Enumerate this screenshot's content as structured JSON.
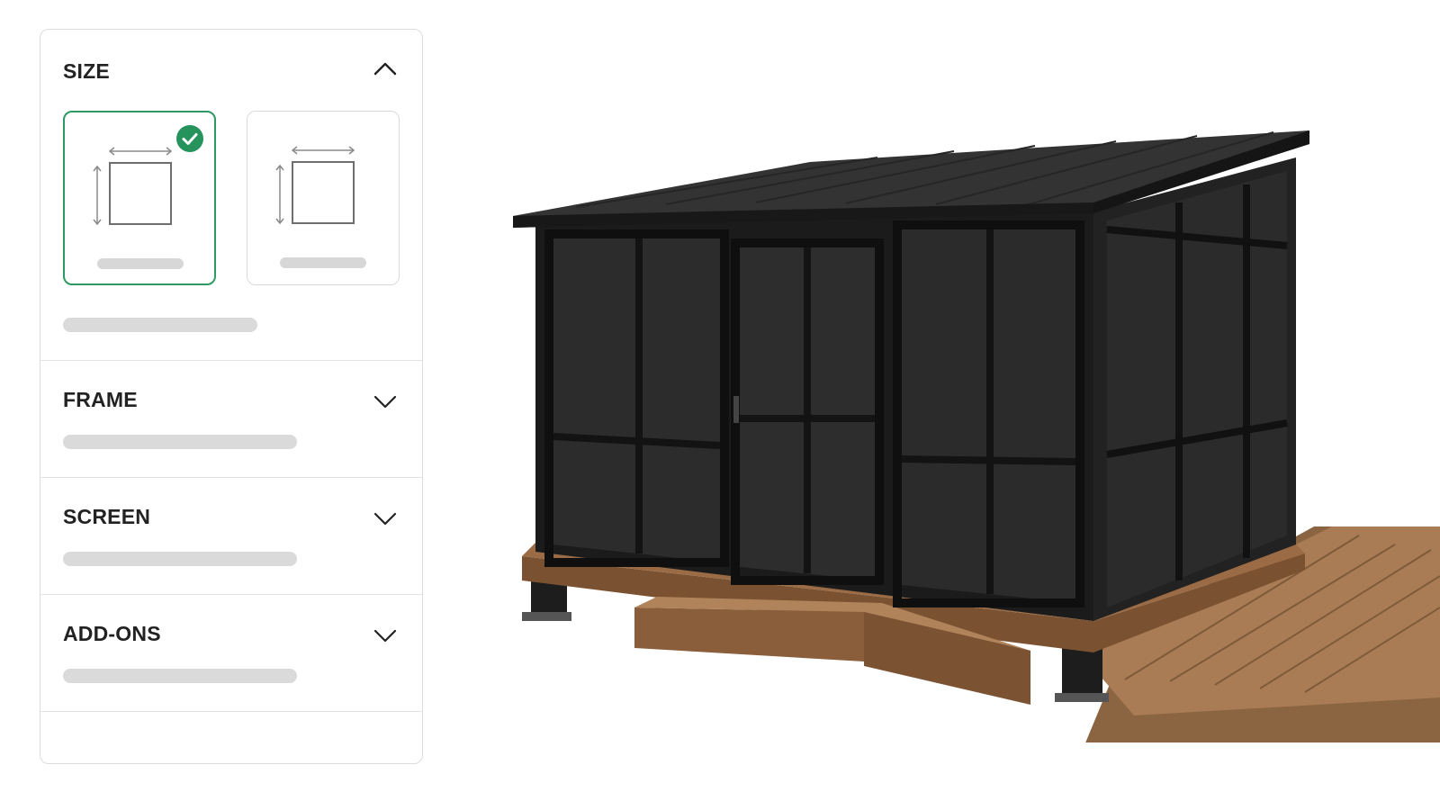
{
  "sections": {
    "size": {
      "title": "SIZE",
      "expanded": true,
      "selected_option": 1
    },
    "frame": {
      "title": "FRAME",
      "expanded": false
    },
    "screen": {
      "title": "SCREEN",
      "expanded": false
    },
    "addons": {
      "title": "ADD-ONS",
      "expanded": false
    }
  },
  "colors": {
    "accent": "#2e9a62",
    "skeleton": "#dadada",
    "border": "#dcdcdc"
  },
  "icons": [
    "chevron-up-icon",
    "chevron-down-icon",
    "check-circle-icon",
    "dimensions-icon"
  ]
}
